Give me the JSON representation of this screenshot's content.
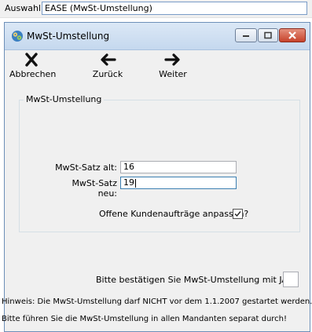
{
  "selection": {
    "label": "Auswahl",
    "value": "EASE (MwSt-Umstellung)"
  },
  "window": {
    "title": "MwSt-Umstellung"
  },
  "toolbar": {
    "cancel_label": "Abbrechen",
    "back_label": "Zurück",
    "next_label": "Weiter"
  },
  "group": {
    "title": "MwSt-Umstellung"
  },
  "form": {
    "old_rate_label": "MwSt-Satz alt:",
    "old_rate_value": "16",
    "new_rate_label": "MwSt-Satz neu:",
    "new_rate_value": "19",
    "adjust_orders_label": "Offene Kundenaufträge anpassen?",
    "adjust_orders_checked": true,
    "confirm_label": "Bitte bestätigen Sie MwSt-Umstellung mit JA:",
    "confirm_value": ""
  },
  "hints": {
    "line1": "Hinweis: Die MwSt-Umstellung darf NICHT vor dem 1.1.2007 gestartet werden.",
    "line2": "Bitte führen Sie die MwSt-Umstellung in allen Mandanten separat durch!"
  },
  "icons": {
    "app": "gear-app-icon",
    "cancel": "x-icon",
    "back": "arrow-left-icon",
    "next": "arrow-right-icon",
    "check": "checkmark-icon"
  },
  "colors": {
    "title_gradient_top": "#dbe8f6",
    "close_button": "#c7432b",
    "active_input_border": "#3c7fb1"
  }
}
